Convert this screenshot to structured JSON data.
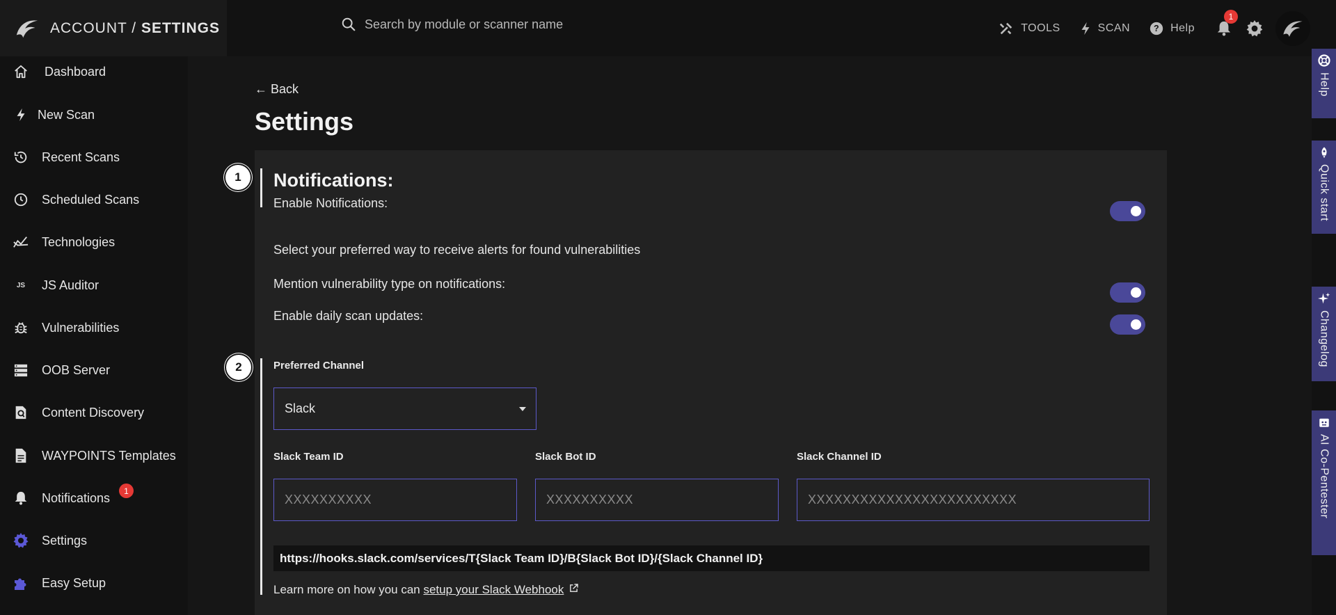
{
  "brand": {
    "prefix": "ACCOUNT / ",
    "title_bold": "SETTINGS"
  },
  "search": {
    "placeholder": "Search by module or scanner name"
  },
  "topnav": {
    "tools": "TOOLS",
    "scan": "SCAN",
    "help": "Help",
    "notification_count": "1"
  },
  "sidebar": {
    "items": [
      {
        "label": "Dashboard",
        "icon": "home-icon"
      },
      {
        "label": "New Scan",
        "icon": "bolt-icon"
      },
      {
        "label": "Recent Scans",
        "icon": "history-icon"
      },
      {
        "label": "Scheduled Scans",
        "icon": "clock-icon"
      },
      {
        "label": "Technologies",
        "icon": "chart-icon"
      },
      {
        "label": "JS Auditor",
        "icon": "js-icon",
        "icon_text": "JS"
      },
      {
        "label": "Vulnerabilities",
        "icon": "bug-icon"
      },
      {
        "label": "OOB Server",
        "icon": "server-icon"
      },
      {
        "label": "Content Discovery",
        "icon": "document-search-icon"
      },
      {
        "label": "WAYPOINTS Templates",
        "icon": "file-icon"
      },
      {
        "label": "Notifications",
        "icon": "bell-icon",
        "badge": "1"
      },
      {
        "label": "Settings",
        "icon": "gear-icon",
        "active_color": "#5b58d6"
      },
      {
        "label": "Easy Setup",
        "icon": "puzzle-icon",
        "active_color": "#5b58d6"
      }
    ]
  },
  "rail": {
    "help": "Help",
    "quickstart": "Quick start",
    "changelog": "Changelog",
    "copentester": "AI Co-Pentester"
  },
  "main": {
    "back": "← Back",
    "title": "Settings",
    "steps": [
      "1",
      "2"
    ],
    "notifications_heading": "Notifications:",
    "enable_notifications": "Enable Notifications:",
    "preferred_way": "Select your preferred way to receive alerts for found vulnerabilities",
    "mention_type": "Mention vulnerability type on notifications:",
    "daily_updates": "Enable daily scan updates:",
    "preferred_channel_label": "Preferred Channel",
    "preferred_channel_value": "Slack",
    "fields": {
      "team_label": "Slack Team ID",
      "team_placeholder": "XXXXXXXXXX",
      "bot_label": "Slack Bot ID",
      "bot_placeholder": "XXXXXXXXXX",
      "channel_label": "Slack Channel ID",
      "channel_placeholder": "XXXXXXXXXXXXXXXXXXXXXXXX"
    },
    "webhook_url": "https://hooks.slack.com/services/T{Slack Team ID}/B{Slack Bot ID}/{Slack Channel ID}",
    "learn_prefix": "Learn more on how you can ",
    "learn_link": "setup your Slack Webhook"
  },
  "colors": {
    "accent": "#5b58d6",
    "toggle": "#4a4899",
    "rail": "#3c3a78",
    "badge": "#e53935"
  }
}
